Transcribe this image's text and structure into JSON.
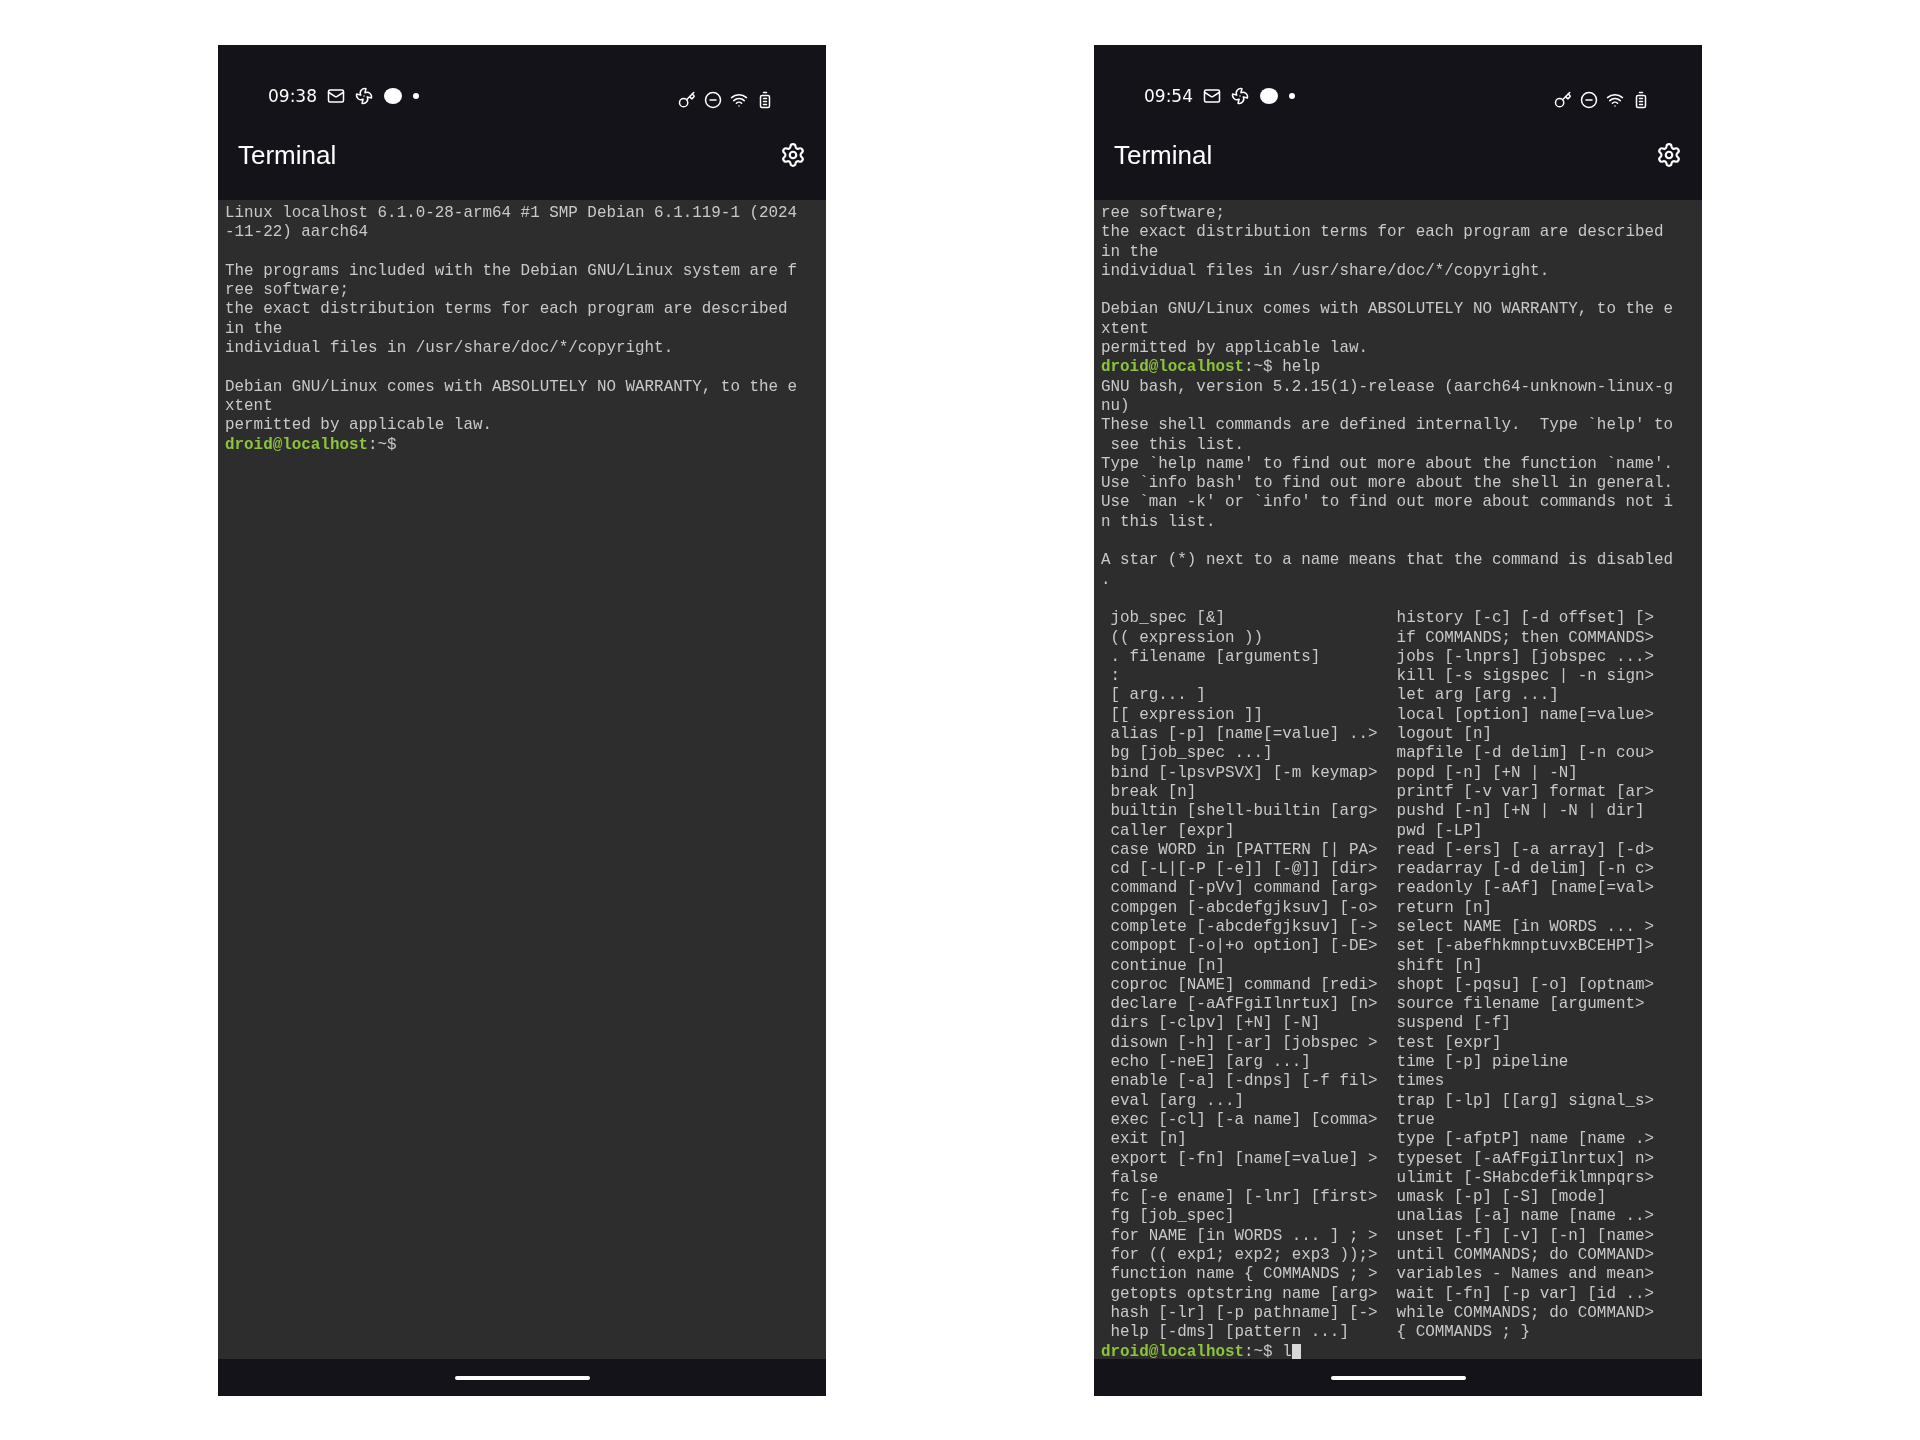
{
  "phones": [
    {
      "status_bar": {
        "time": "09:38"
      },
      "app_bar": {
        "title": "Terminal"
      },
      "terminal": {
        "lines": [
          {
            "kind": "text",
            "text": "Linux localhost 6.1.0-28-arm64 #1 SMP Debian 6.1.119-1 (2024"
          },
          {
            "kind": "text",
            "text": "-11-22) aarch64"
          },
          {
            "kind": "blank"
          },
          {
            "kind": "text",
            "text": "The programs included with the Debian GNU/Linux system are f"
          },
          {
            "kind": "text",
            "text": "ree software;"
          },
          {
            "kind": "text",
            "text": "the exact distribution terms for each program are described"
          },
          {
            "kind": "text",
            "text": "in the"
          },
          {
            "kind": "text",
            "text": "individual files in /usr/share/doc/*/copyright."
          },
          {
            "kind": "blank"
          },
          {
            "kind": "text",
            "text": "Debian GNU/Linux comes with ABSOLUTELY NO WARRANTY, to the e"
          },
          {
            "kind": "text",
            "text": "xtent"
          },
          {
            "kind": "text",
            "text": "permitted by applicable law."
          },
          {
            "kind": "prompt",
            "user": "droid@localhost",
            "path": ":~$",
            "cursor": false
          }
        ]
      }
    },
    {
      "status_bar": {
        "time": "09:54"
      },
      "app_bar": {
        "title": "Terminal"
      },
      "terminal": {
        "lines": [
          {
            "kind": "text",
            "text": "ree software;"
          },
          {
            "kind": "text",
            "text": "the exact distribution terms for each program are described"
          },
          {
            "kind": "text",
            "text": "in the"
          },
          {
            "kind": "text",
            "text": "individual files in /usr/share/doc/*/copyright."
          },
          {
            "kind": "blank"
          },
          {
            "kind": "text",
            "text": "Debian GNU/Linux comes with ABSOLUTELY NO WARRANTY, to the e"
          },
          {
            "kind": "text",
            "text": "xtent"
          },
          {
            "kind": "text",
            "text": "permitted by applicable law."
          },
          {
            "kind": "prompt",
            "user": "droid@localhost",
            "path": ":~$",
            "command": "help",
            "cursor": false
          },
          {
            "kind": "text",
            "text": "GNU bash, version 5.2.15(1)-release (aarch64-unknown-linux-g"
          },
          {
            "kind": "text",
            "text": "nu)"
          },
          {
            "kind": "text",
            "text": "These shell commands are defined internally.  Type `help' to"
          },
          {
            "kind": "text",
            "text": " see this list."
          },
          {
            "kind": "text",
            "text": "Type `help name' to find out more about the function `name'."
          },
          {
            "kind": "text",
            "text": "Use `info bash' to find out more about the shell in general."
          },
          {
            "kind": "text",
            "text": "Use `man -k' or `info' to find out more about commands not i"
          },
          {
            "kind": "text",
            "text": "n this list."
          },
          {
            "kind": "blank"
          },
          {
            "kind": "text",
            "text": "A star (*) next to a name means that the command is disabled"
          },
          {
            "kind": "text",
            "text": "."
          },
          {
            "kind": "blank"
          },
          {
            "kind": "columns",
            "left": "job_spec [&]",
            "right": "history [-c] [-d offset] [>"
          },
          {
            "kind": "columns",
            "left": "(( expression ))",
            "right": "if COMMANDS; then COMMANDS>"
          },
          {
            "kind": "columns",
            "left": ". filename [arguments]",
            "right": "jobs [-lnprs] [jobspec ...>"
          },
          {
            "kind": "columns",
            "left": ":",
            "right": "kill [-s sigspec | -n sign>"
          },
          {
            "kind": "columns",
            "left": "[ arg... ]",
            "right": "let arg [arg ...]"
          },
          {
            "kind": "columns",
            "left": "[[ expression ]]",
            "right": "local [option] name[=value>"
          },
          {
            "kind": "columns",
            "left": "alias [-p] [name[=value] ..>",
            "right": "logout [n]"
          },
          {
            "kind": "columns",
            "left": "bg [job_spec ...]",
            "right": "mapfile [-d delim] [-n cou>"
          },
          {
            "kind": "columns",
            "left": "bind [-lpsvPSVX] [-m keymap>",
            "right": "popd [-n] [+N | -N]"
          },
          {
            "kind": "columns",
            "left": "break [n]",
            "right": "printf [-v var] format [ar>"
          },
          {
            "kind": "columns",
            "left": "builtin [shell-builtin [arg>",
            "right": "pushd [-n] [+N | -N | dir]"
          },
          {
            "kind": "columns",
            "left": "caller [expr]",
            "right": "pwd [-LP]"
          },
          {
            "kind": "columns",
            "left": "case WORD in [PATTERN [| PA>",
            "right": "read [-ers] [-a array] [-d>"
          },
          {
            "kind": "columns",
            "left": "cd [-L|[-P [-e]] [-@]] [dir>",
            "right": "readarray [-d delim] [-n c>"
          },
          {
            "kind": "columns",
            "left": "command [-pVv] command [arg>",
            "right": "readonly [-aAf] [name[=val>"
          },
          {
            "kind": "columns",
            "left": "compgen [-abcdefgjksuv] [-o>",
            "right": "return [n]"
          },
          {
            "kind": "columns",
            "left": "complete [-abcdefgjksuv] [->",
            "right": "select NAME [in WORDS ... >"
          },
          {
            "kind": "columns",
            "left": "compopt [-o|+o option] [-DE>",
            "right": "set [-abefhkmnptuvxBCEHPT]>"
          },
          {
            "kind": "columns",
            "left": "continue [n]",
            "right": "shift [n]"
          },
          {
            "kind": "columns",
            "left": "coproc [NAME] command [redi>",
            "right": "shopt [-pqsu] [-o] [optnam>"
          },
          {
            "kind": "columns",
            "left": "declare [-aAfFgiIlnrtux] [n>",
            "right": "source filename [argument>"
          },
          {
            "kind": "columns",
            "left": "dirs [-clpv] [+N] [-N]",
            "right": "suspend [-f]"
          },
          {
            "kind": "columns",
            "left": "disown [-h] [-ar] [jobspec >",
            "right": "test [expr]"
          },
          {
            "kind": "columns",
            "left": "echo [-neE] [arg ...]",
            "right": "time [-p] pipeline"
          },
          {
            "kind": "columns",
            "left": "enable [-a] [-dnps] [-f fil>",
            "right": "times"
          },
          {
            "kind": "columns",
            "left": "eval [arg ...]",
            "right": "trap [-lp] [[arg] signal_s>"
          },
          {
            "kind": "columns",
            "left": "exec [-cl] [-a name] [comma>",
            "right": "true"
          },
          {
            "kind": "columns",
            "left": "exit [n]",
            "right": "type [-afptP] name [name .>"
          },
          {
            "kind": "columns",
            "left": "export [-fn] [name[=value] >",
            "right": "typeset [-aAfFgiIlnrtux] n>"
          },
          {
            "kind": "columns",
            "left": "false",
            "right": "ulimit [-SHabcdefiklmnpqrs>"
          },
          {
            "kind": "columns",
            "left": "fc [-e ename] [-lnr] [first>",
            "right": "umask [-p] [-S] [mode]"
          },
          {
            "kind": "columns",
            "left": "fg [job_spec]",
            "right": "unalias [-a] name [name ..>"
          },
          {
            "kind": "columns",
            "left": "for NAME [in WORDS ... ] ; >",
            "right": "unset [-f] [-v] [-n] [name>"
          },
          {
            "kind": "columns",
            "left": "for (( exp1; exp2; exp3 ));>",
            "right": "until COMMANDS; do COMMAND>"
          },
          {
            "kind": "columns",
            "left": "function name { COMMANDS ; >",
            "right": "variables - Names and mean>"
          },
          {
            "kind": "columns",
            "left": "getopts optstring name [arg>",
            "right": "wait [-fn] [-p var] [id ..>"
          },
          {
            "kind": "columns",
            "left": "hash [-lr] [-p pathname] [->",
            "right": "while COMMANDS; do COMMAND>"
          },
          {
            "kind": "columns",
            "left": "help [-dms] [pattern ...]",
            "right": "{ COMMANDS ; }"
          },
          {
            "kind": "prompt",
            "user": "droid@localhost",
            "path": ":~$",
            "command": "l",
            "cursor": true
          }
        ]
      }
    }
  ]
}
